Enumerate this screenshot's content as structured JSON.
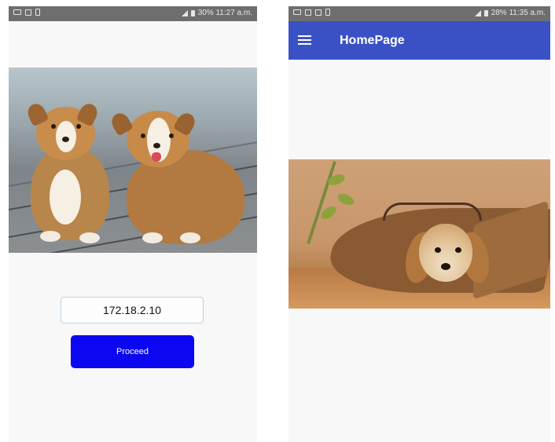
{
  "left_screen": {
    "status_bar": {
      "right_text": "30% 11:27 a.m."
    },
    "image": {
      "subject": "two-puppies-photo"
    },
    "ip_field": {
      "value": "172.18.2.10"
    },
    "proceed_button": {
      "label": "Proceed"
    },
    "colors": {
      "button": "#0b07f0",
      "field_border": "#b9d6e6"
    }
  },
  "right_screen": {
    "status_bar": {
      "right_text": "28% 11:35 a.m."
    },
    "app_bar": {
      "title": "HomePage",
      "menu_icon": "hamburger-menu-icon"
    },
    "image": {
      "subject": "puppy-in-paper-bag-photo"
    },
    "colors": {
      "app_bar": "#3a51c6"
    }
  }
}
